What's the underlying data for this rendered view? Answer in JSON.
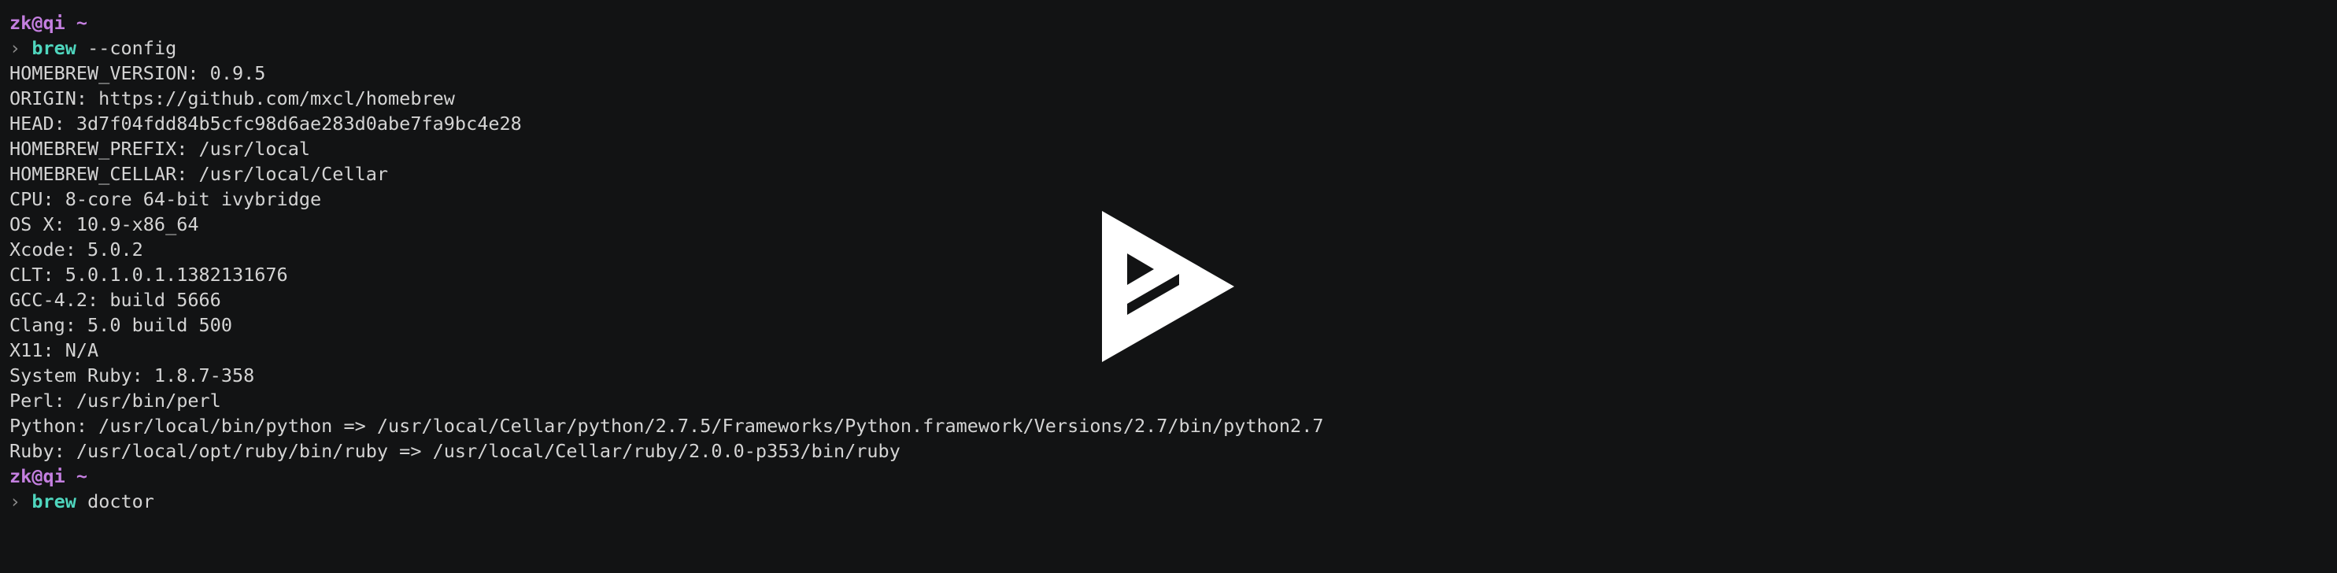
{
  "prompt1": {
    "user": "zk@qi",
    "dir": "~",
    "arrow": "›",
    "cmd": "brew",
    "args": "--config"
  },
  "config_lines": [
    "HOMEBREW_VERSION: 0.9.5",
    "ORIGIN: https://github.com/mxcl/homebrew",
    "HEAD: 3d7f04fdd84b5cfc98d6ae283d0abe7fa9bc4e28",
    "HOMEBREW_PREFIX: /usr/local",
    "HOMEBREW_CELLAR: /usr/local/Cellar",
    "CPU: 8-core 64-bit ivybridge",
    "OS X: 10.9-x86_64",
    "Xcode: 5.0.2",
    "CLT: 5.0.1.0.1.1382131676",
    "GCC-4.2: build 5666",
    "Clang: 5.0 build 500",
    "X11: N/A",
    "System Ruby: 1.8.7-358",
    "Perl: /usr/bin/perl",
    "Python: /usr/local/bin/python => /usr/local/Cellar/python/2.7.5/Frameworks/Python.framework/Versions/2.7/bin/python2.7",
    "Ruby: /usr/local/opt/ruby/bin/ruby => /usr/local/Cellar/ruby/2.0.0-p353/bin/ruby"
  ],
  "prompt2": {
    "user": "zk@qi",
    "dir": "~",
    "arrow": "›",
    "cmd": "brew",
    "args": "doctor"
  },
  "overlay": {
    "icon": "asciinema-play-icon",
    "color": "#ffffff"
  },
  "colors": {
    "background": "#121314",
    "text": "#d4d4d4",
    "prompt_user": "#c47fe0",
    "command": "#4fd6be",
    "arrow": "#8a8a8a"
  }
}
